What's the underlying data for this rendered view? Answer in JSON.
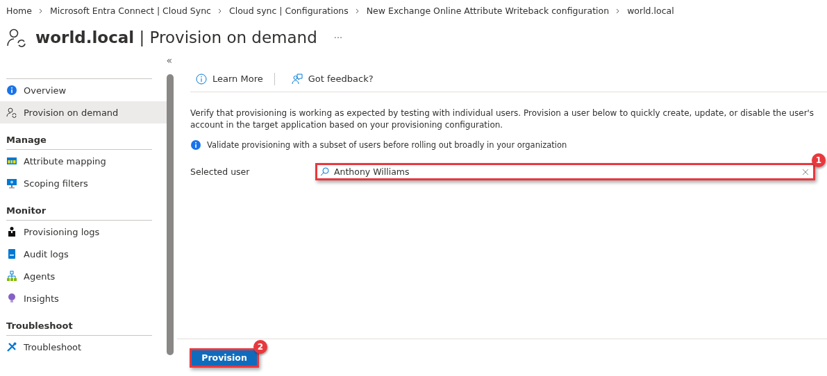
{
  "breadcrumb": [
    "Home",
    "Microsoft Entra Connect | Cloud Sync",
    "Cloud sync | Configurations",
    "New Exchange Online Attribute Writeback configuration",
    "world.local"
  ],
  "header": {
    "resource": "world.local",
    "separator": "|",
    "page": "Provision on demand",
    "more": "···"
  },
  "sidebar": {
    "collapse": "«",
    "sections": [
      {
        "items": [
          {
            "label": "Overview",
            "kind": "info",
            "selected": false
          },
          {
            "label": "Provision on demand",
            "kind": "user-sync",
            "selected": true
          }
        ]
      },
      {
        "title": "Manage",
        "items": [
          {
            "label": "Attribute mapping",
            "kind": "table",
            "selected": false
          },
          {
            "label": "Scoping filters",
            "kind": "monitor",
            "selected": false
          }
        ]
      },
      {
        "title": "Monitor",
        "items": [
          {
            "label": "Provisioning logs",
            "kind": "person",
            "selected": false
          },
          {
            "label": "Audit logs",
            "kind": "book",
            "selected": false
          },
          {
            "label": "Agents",
            "kind": "network",
            "selected": false
          },
          {
            "label": "Insights",
            "kind": "bulb",
            "selected": false
          }
        ]
      },
      {
        "title": "Troubleshoot",
        "items": [
          {
            "label": "Troubleshoot",
            "kind": "wrench",
            "selected": false
          }
        ]
      }
    ]
  },
  "toolbar": [
    {
      "label": "Learn More",
      "kind": "info"
    },
    {
      "label": "Got feedback?",
      "kind": "feedback"
    }
  ],
  "description": "Verify that provisioning is working as expected by testing with individual users. Provision a user below to quickly create, update, or disable the user's account in the target application based on your provisioning configuration.",
  "notice": "Validate provisioning with a subset of users before rolling out broadly in your organization",
  "selected_user": {
    "label": "Selected user",
    "value": "Anthony Williams",
    "callout": "1"
  },
  "provision_button": {
    "label": "Provision",
    "callout": "2"
  }
}
